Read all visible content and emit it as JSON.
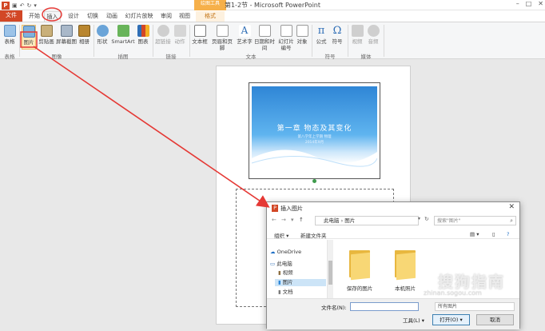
{
  "window": {
    "title": "第1-2节 - Microsoft PowerPoint",
    "context_tab_header": "绘图工具"
  },
  "tabs": [
    "文件",
    "开始",
    "插入",
    "设计",
    "切换",
    "动画",
    "幻灯片放映",
    "审阅",
    "视图",
    "格式"
  ],
  "ribbon": {
    "buttons": {
      "table": "表格",
      "picture": "图片",
      "clipart": "剪贴画",
      "screenshot": "屏幕截图",
      "album": "相册",
      "shapes": "形状",
      "smartart": "SmartArt",
      "chart": "图表",
      "hyperlink": "超链接",
      "action": "动作",
      "textbox": "文本框",
      "header_footer": "页眉和页脚",
      "wordart": "艺术字",
      "datetime": "日期和时间",
      "slide_number": "幻灯片编号",
      "object": "对象",
      "equation": "公式",
      "symbol": "符号",
      "video": "视频",
      "audio": "音频"
    },
    "groups": {
      "tables": "表格",
      "images": "图像",
      "illustrations": "插图",
      "links": "链接",
      "text": "文本",
      "symbols": "符号",
      "media": "媒体"
    }
  },
  "slide": {
    "title": "第一章  物态及其变化",
    "subtitle": "第八学年上学期 物理",
    "date": "2014年9月"
  },
  "dialog": {
    "title": "插入图片",
    "breadcrumb": "此电脑 › 图片",
    "search_placeholder": "搜索\"图片\"",
    "organize": "组织 ▾",
    "new_folder": "新建文件夹",
    "nav_items": [
      "OneDrive",
      "此电脑",
      "视频",
      "图片",
      "文档"
    ],
    "folders": [
      "保存的图片",
      "本机照片"
    ],
    "filename_label": "文件名(N):",
    "filename_value": "",
    "filter_value": "所有图片",
    "tools": "工具(L)",
    "open": "打开(O)",
    "cancel": "取消"
  },
  "watermark": {
    "cn": "搜狗指南",
    "en": "zhinan.sogou.com"
  },
  "colors": {
    "file_tab": "#d24726",
    "annotation": "#e53935",
    "slide_blue": "#2f86d6"
  }
}
